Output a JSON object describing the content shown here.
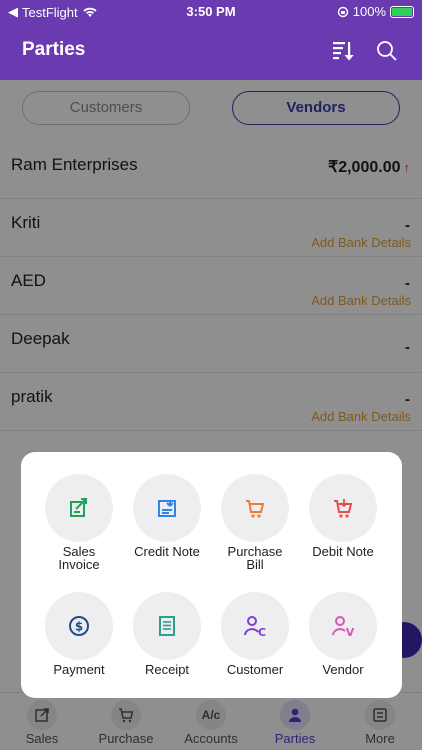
{
  "status_bar": {
    "carrier": "TestFlight",
    "time": "3:50 PM",
    "battery": "100%",
    "back_glyph": "◀"
  },
  "header": {
    "title": "Parties",
    "bg_color": "#6a3bb0"
  },
  "segments": {
    "customers": "Customers",
    "vendors": "Vendors",
    "active": "Vendors"
  },
  "parties": [
    {
      "name": "Ram Enterprises",
      "amount": "₹2,000.00",
      "arrow": "↑"
    },
    {
      "name": "Kriti",
      "amount": "-",
      "bank": "Add Bank Details"
    },
    {
      "name": "AED",
      "amount": "-",
      "bank": "Add Bank Details"
    },
    {
      "name": "Deepak",
      "amount": "-"
    },
    {
      "name": "pratik",
      "amount": "-",
      "bank": "Add Bank Details"
    }
  ],
  "actions": [
    {
      "label": "Sales Invoice",
      "icon": "sales-invoice-icon",
      "color": "#1ea45a"
    },
    {
      "label": "Credit Note",
      "icon": "credit-note-icon",
      "color": "#2f86e8"
    },
    {
      "label": "Purchase Bill",
      "icon": "purchase-bill-icon",
      "color": "#f07c2f"
    },
    {
      "label": "Debit Note",
      "icon": "debit-note-icon",
      "color": "#e84b4b"
    },
    {
      "label": "Payment",
      "icon": "payment-icon",
      "color": "#1f4d8c"
    },
    {
      "label": "Receipt",
      "icon": "receipt-icon",
      "color": "#2aa189"
    },
    {
      "label": "Customer",
      "icon": "customer-icon",
      "color": "#7a3fd6"
    },
    {
      "label": "Vendor",
      "icon": "vendor-icon",
      "color": "#d857b3"
    }
  ],
  "tabs": [
    {
      "label": "Sales",
      "icon": "sales-icon"
    },
    {
      "label": "Purchase",
      "icon": "purchase-icon"
    },
    {
      "label": "Accounts",
      "icon_text": "A/c"
    },
    {
      "label": "Parties",
      "icon": "parties-icon",
      "active": true
    },
    {
      "label": "More",
      "icon": "more-icon"
    }
  ]
}
